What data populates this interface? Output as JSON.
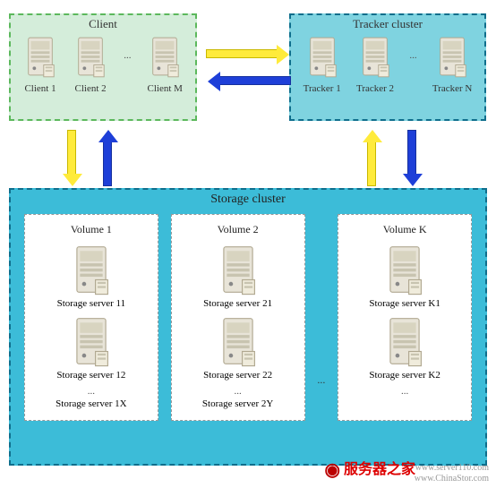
{
  "client": {
    "title": "Client",
    "nodes": [
      "Client 1",
      "Client 2",
      "Client M"
    ],
    "ellipsis": "..."
  },
  "tracker": {
    "title": "Tracker cluster",
    "nodes": [
      "Tracker 1",
      "Tracker 2",
      "Tracker N"
    ],
    "ellipsis": "..."
  },
  "storage": {
    "title": "Storage cluster",
    "volumes": [
      {
        "title": "Volume 1",
        "servers": [
          "Storage server 11",
          "Storage server 12"
        ],
        "last": "Storage server 1X"
      },
      {
        "title": "Volume 2",
        "servers": [
          "Storage server 21",
          "Storage server 22"
        ],
        "last": "Storage server 2Y"
      },
      {
        "title": "Volume K",
        "servers": [
          "Storage server K1",
          "Storage server K2"
        ],
        "last": ""
      }
    ],
    "ellipsis": "..."
  },
  "branding": {
    "logo": "服务器之家",
    "url1": "www.server110.com",
    "url2": "www.ChinaStor.com"
  }
}
